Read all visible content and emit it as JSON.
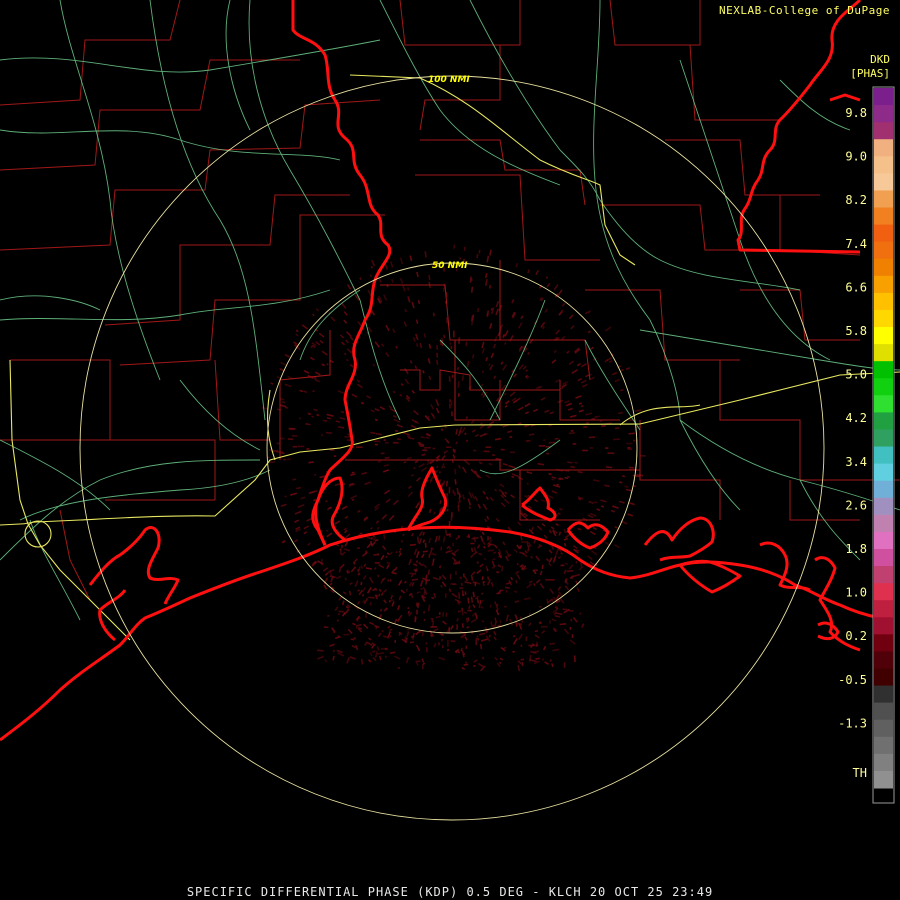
{
  "credit": "NEXLAB-College of DuPage",
  "product": {
    "code": "DKD",
    "unit": "[PHAS]"
  },
  "range_rings": {
    "inner": "50 NMI",
    "outer": "100 NMI"
  },
  "legend": {
    "ticks": [
      "9.8",
      "9.0",
      "8.2",
      "7.4",
      "6.6",
      "5.8",
      "5.0",
      "4.2",
      "3.4",
      "2.6",
      "1.8",
      "1.0",
      "0.2",
      "-0.5",
      "-1.3",
      "TH"
    ],
    "colors": [
      "#7b1f8c",
      "#8e2a8a",
      "#a0306f",
      "#f0b080",
      "#f5c08a",
      "#f7c898",
      "#f0a050",
      "#f08020",
      "#f06010",
      "#f07010",
      "#f08000",
      "#f8a000",
      "#ffc000",
      "#ffd800",
      "#ffff00",
      "#e0e000",
      "#00c000",
      "#10d010",
      "#30e030",
      "#20a040",
      "#30a060",
      "#40c0c0",
      "#60d0e0",
      "#70b0d8",
      "#a090c0",
      "#c080b0",
      "#e070c0",
      "#d050a0",
      "#c04070",
      "#e03050",
      "#c02040",
      "#a01030",
      "#700010",
      "#500008",
      "#400000",
      "#303030",
      "#505050",
      "#606060",
      "#707070",
      "#808080",
      "#909090"
    ]
  },
  "footer": "SPECIFIC DIFFERENTIAL PHASE (KDP) 0.5 DEG - KLCH 20 OCT 25 23:49"
}
